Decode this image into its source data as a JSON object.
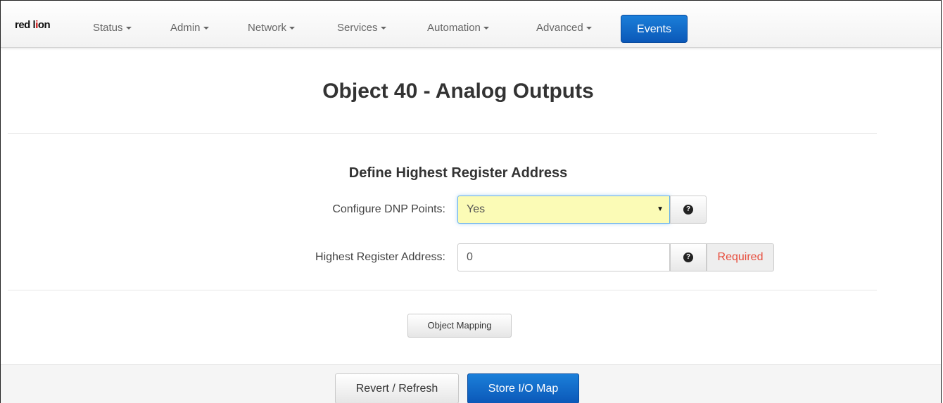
{
  "brand": {
    "logo_text_a": "red l",
    "logo_mark": "i",
    "logo_text_b": "on"
  },
  "nav": {
    "items": [
      {
        "label": "Status"
      },
      {
        "label": "Admin"
      },
      {
        "label": "Network"
      },
      {
        "label": "Services"
      },
      {
        "label": "Automation"
      },
      {
        "label": "Advanced"
      }
    ],
    "active": {
      "label": "Events"
    }
  },
  "page": {
    "title": "Object 40 - Analog Outputs",
    "section_title": "Define Highest Register Address"
  },
  "form": {
    "configure_label": "Configure DNP Points:",
    "configure_value": "Yes",
    "highest_label": "Highest Register Address:",
    "highest_value": "0",
    "required_text": "Required",
    "help_glyph": "?"
  },
  "actions": {
    "object_mapping": "Object Mapping",
    "revert": "Revert / Refresh",
    "store": "Store I/O Map"
  },
  "colors": {
    "primary": "#0b58b8",
    "select_bg": "#fbfbb6",
    "required": "#e74c3c"
  }
}
